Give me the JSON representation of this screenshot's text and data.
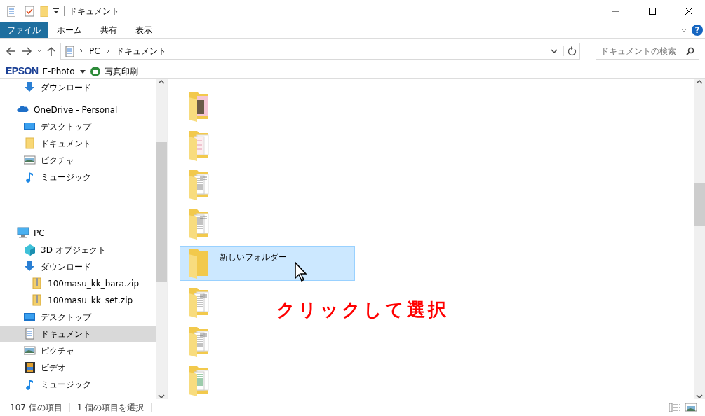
{
  "window": {
    "title": "ドキュメント"
  },
  "ribbon": {
    "tabs": [
      {
        "label": "ファイル",
        "kind": "file",
        "selected": false
      },
      {
        "label": "ホーム",
        "kind": "tab",
        "selected": false
      },
      {
        "label": "共有",
        "kind": "tab",
        "selected": false
      },
      {
        "label": "表示",
        "kind": "tab",
        "selected": false
      }
    ]
  },
  "help": "?",
  "address": {
    "breadcrumb": [
      "PC",
      "ドキュメント"
    ],
    "search": {
      "placeholder": "ドキュメントの検索"
    }
  },
  "epson_toolbar": {
    "brand": "EPSON",
    "app": "E-Photo",
    "action": "写真印刷"
  },
  "nav": {
    "partial_items": [
      {
        "label": "ダウンロード",
        "kind": "download",
        "selected": false
      }
    ],
    "groups": [
      {
        "label": "OneDrive - Personal",
        "kind": "cloud",
        "selected": false,
        "children": [
          {
            "label": "デスクトップ",
            "kind": "desktop",
            "selected": false
          },
          {
            "label": "ドキュメント",
            "kind": "folder",
            "selected": false
          },
          {
            "label": "ピクチャ",
            "kind": "pictures",
            "selected": false
          },
          {
            "label": "ミュージック",
            "kind": "music",
            "selected": false
          }
        ]
      },
      {
        "label": "PC",
        "kind": "pc",
        "selected": false,
        "children": [
          {
            "label": "3D オブジェクト",
            "kind": "cube",
            "selected": false
          },
          {
            "label": "ダウンロード",
            "kind": "download",
            "selected": false,
            "children": [
              {
                "label": "100masu_kk_bara.zip",
                "kind": "zip",
                "selected": false
              },
              {
                "label": "100masu_kk_set.zip",
                "kind": "zip",
                "selected": false
              }
            ]
          },
          {
            "label": "デスクトップ",
            "kind": "desktop",
            "selected": false
          },
          {
            "label": "ドキュメント",
            "kind": "document",
            "selected": true
          },
          {
            "label": "ピクチャ",
            "kind": "pictures",
            "selected": false
          },
          {
            "label": "ビデオ",
            "kind": "video",
            "selected": false
          },
          {
            "label": "ミュージック",
            "kind": "music",
            "selected": false
          }
        ]
      }
    ]
  },
  "files": [
    {
      "kind": "photo",
      "selected": false
    },
    {
      "kind": "pink",
      "selected": false
    },
    {
      "kind": "document",
      "selected": false
    },
    {
      "kind": "document",
      "selected": false
    },
    {
      "kind": "empty",
      "name": "新しいフォルダー",
      "selected": true
    },
    {
      "kind": "document",
      "selected": false
    },
    {
      "kind": "document",
      "selected": false
    },
    {
      "kind": "spreadsheet",
      "selected": false
    }
  ],
  "annotation": "クリックして選択",
  "status_bar": {
    "count": "107 個の項目",
    "selection": "1 個の項目を選択"
  }
}
